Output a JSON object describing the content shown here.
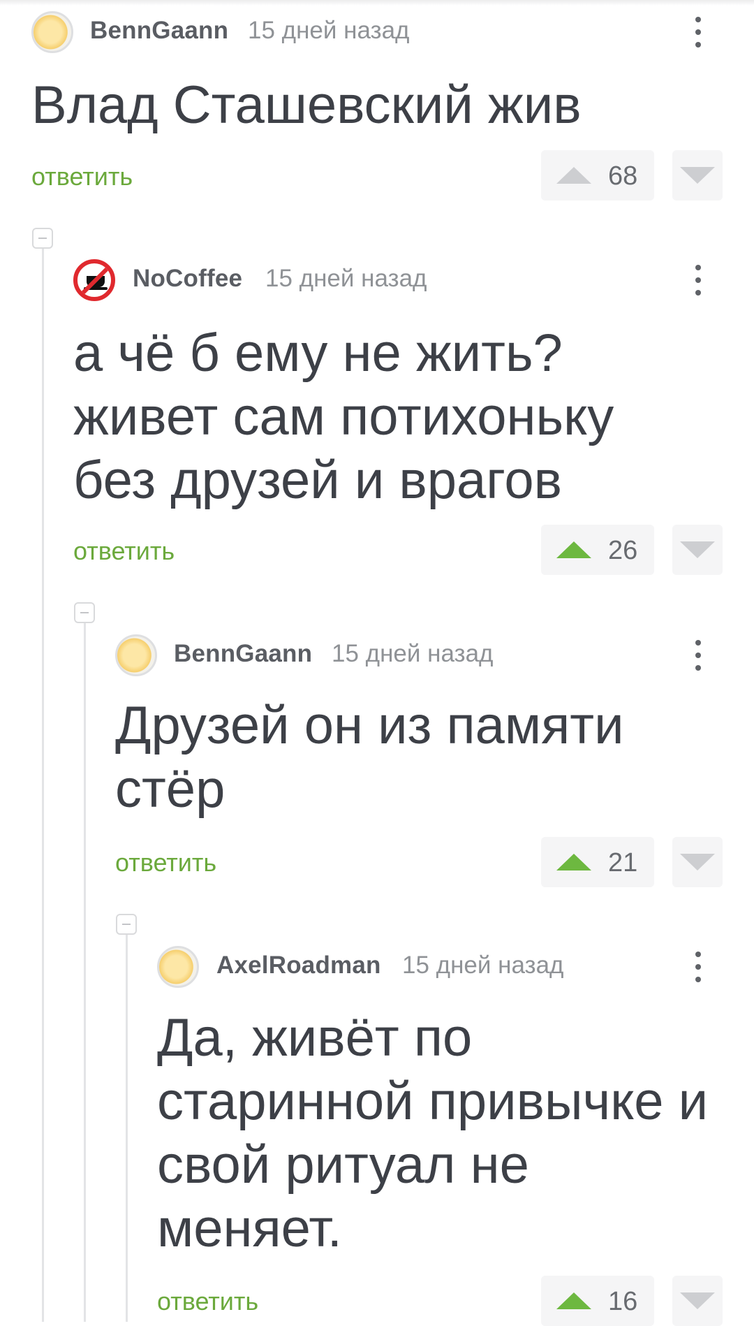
{
  "comments": [
    {
      "username": "BennGaann",
      "time": "15 дней назад",
      "text": "Влад Сташевский жив",
      "reply_label": "ответить",
      "rating": "68",
      "upvoted": false,
      "avatar_icon": "emoji-face-avatar-icon"
    },
    {
      "username": "NoCoffee",
      "time": "15 дней назад",
      "text": "а чё б ему не жить? живет сам потихоньку без друзей и врагов",
      "reply_label": "ответить",
      "rating": "26",
      "upvoted": true,
      "avatar_icon": "no-coffee-sign-avatar-icon"
    },
    {
      "username": "BennGaann",
      "time": "15 дней назад",
      "text": "Друзей он из памяти стёр",
      "reply_label": "ответить",
      "rating": "21",
      "upvoted": true,
      "avatar_icon": "emoji-face-avatar-icon"
    },
    {
      "username": "AxelRoadman",
      "time": "15 дней назад",
      "text": "Да, живёт по старинной привычке и свой ритуал не меняет.",
      "reply_label": "ответить",
      "rating": "16",
      "upvoted": true,
      "avatar_icon": "emoji-face-avatar-icon"
    }
  ],
  "colors": {
    "reply_link": "#6ba93c",
    "upvote_active": "#6db840",
    "vote_inactive": "#cdced1",
    "text": "#3d4047",
    "muted": "#8f9296"
  }
}
